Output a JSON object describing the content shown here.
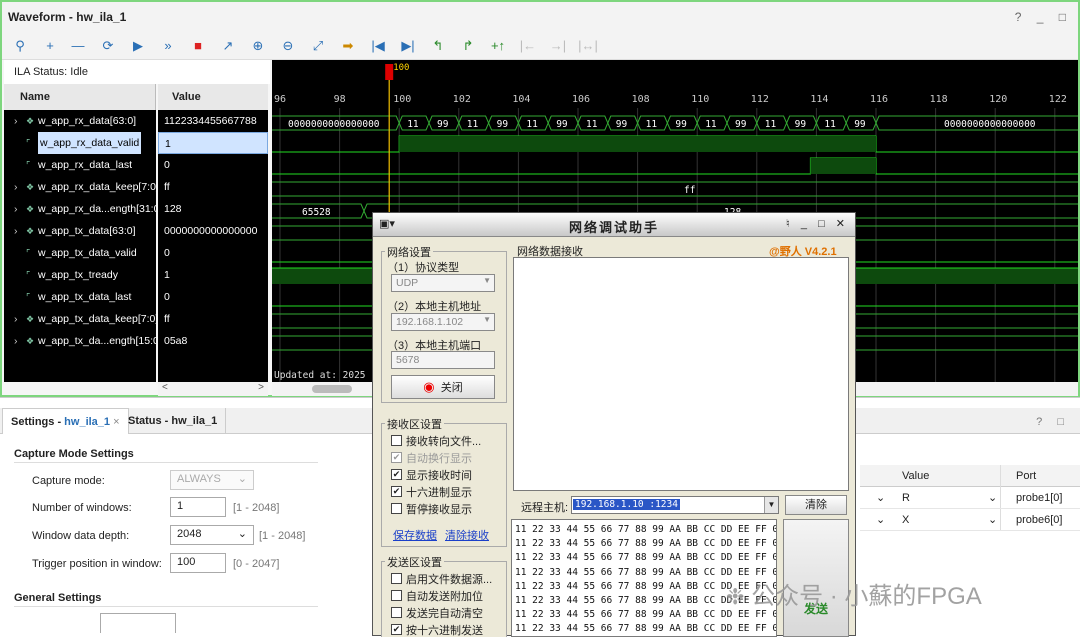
{
  "window": {
    "title": "Waveform - hw_ila_1",
    "ctrls": "? _ □"
  },
  "ila_status": "ILA Status:  Idle",
  "columns": {
    "name": "Name",
    "value": "Value"
  },
  "signals": [
    {
      "name": "w_app_rx_data[63:0]",
      "value": "1122334455667788",
      "bus": true
    },
    {
      "name": "w_app_rx_data_valid",
      "value": "1",
      "bus": false,
      "sel": true
    },
    {
      "name": "w_app_rx_data_last",
      "value": "0",
      "bus": false
    },
    {
      "name": "w_app_rx_data_keep[7:0]",
      "value": "ff",
      "bus": true
    },
    {
      "name": "w_app_rx_da...ength[31:0]",
      "value": "128",
      "bus": true
    },
    {
      "name": "w_app_tx_data[63:0]",
      "value": "0000000000000000",
      "bus": true
    },
    {
      "name": "w_app_tx_data_valid",
      "value": "0",
      "bus": false
    },
    {
      "name": "w_app_tx_tready",
      "value": "1",
      "bus": false
    },
    {
      "name": "w_app_tx_data_last",
      "value": "0",
      "bus": false
    },
    {
      "name": "w_app_tx_data_keep[7:0]",
      "value": "ff",
      "bus": true
    },
    {
      "name": "w_app_tx_da...ength[15:0]",
      "value": "05a8",
      "bus": true
    }
  ],
  "wave": {
    "ticks": [
      "96",
      "98",
      "100",
      "102",
      "104",
      "106",
      "108",
      "110",
      "112",
      "114",
      "116",
      "118",
      "120",
      "122"
    ],
    "cursor_label": "100",
    "rx_data_idle": "0000000000000000",
    "rx_data_cells": [
      "11",
      "99",
      "11",
      "99",
      "11",
      "99",
      "11",
      "99",
      "11",
      "99",
      "11",
      "99",
      "11",
      "99",
      "11",
      "99"
    ],
    "rx_keep": "ff",
    "rx_len_left": "65528",
    "rx_len_right": "128",
    "updated": "Updated at: 2025"
  },
  "settings": {
    "tabs": [
      {
        "label": "Settings - ",
        "sub": "hw_ila_1",
        "close": "×"
      },
      {
        "label": "Status - hw_ila_1"
      }
    ],
    "help": "? □",
    "capture_header": "Capture Mode Settings",
    "capture_mode_label": "Capture mode:",
    "capture_mode_value": "ALWAYS",
    "windows_label": "Number of windows:",
    "windows_value": "1",
    "windows_range": "[1 - 2048]",
    "depth_label": "Window data depth:",
    "depth_value": "2048",
    "depth_range": "[1 - 2048]",
    "trigger_label": "Trigger position in window:",
    "trigger_value": "100",
    "trigger_range": "[0 - 2047]",
    "general_header": "General Settings",
    "table_headers": [
      "Value",
      "Port"
    ],
    "table_rows": [
      [
        "R",
        "probe1[0]"
      ],
      [
        "X",
        "probe6[0]"
      ]
    ]
  },
  "net": {
    "title": "网络调试助手",
    "version": "@野人 V4.2.1",
    "net_group": "网络设置",
    "proto_label": "（1）协议类型",
    "proto_value": "UDP",
    "host_label": "（2）本地主机地址",
    "host_value": "192.168.1.102",
    "port_label": "（3）本地主机端口",
    "port_value": "5678",
    "close_btn": "关闭",
    "recv_group": "接收区设置",
    "recv_opts": [
      {
        "label": "接收转向文件...",
        "checked": false
      },
      {
        "label": "自动换行显示",
        "checked": true,
        "dis": true
      },
      {
        "label": "显示接收时间",
        "checked": true
      },
      {
        "label": "十六进制显示",
        "checked": true
      },
      {
        "label": "暂停接收显示",
        "checked": false
      }
    ],
    "save_link": "保存数据",
    "clear_link": "清除接收",
    "send_group": "发送区设置",
    "send_opts": [
      {
        "label": "启用文件数据源...",
        "checked": false
      },
      {
        "label": "自动发送附加位",
        "checked": false
      },
      {
        "label": "发送完自动清空",
        "checked": false
      },
      {
        "label": "按十六进制发送",
        "checked": true
      }
    ],
    "recv_area": "网络数据接收",
    "remote_label": "远程主机:",
    "remote_value": "192.168.1.10 :1234",
    "clear_btn": "清除",
    "hex_line": "11 22 33 44 55 66 77 88 99 AA BB CC DD EE FF 00",
    "send_btn": "发送"
  },
  "watermark": "公众号 · 小蘇的FPGA"
}
